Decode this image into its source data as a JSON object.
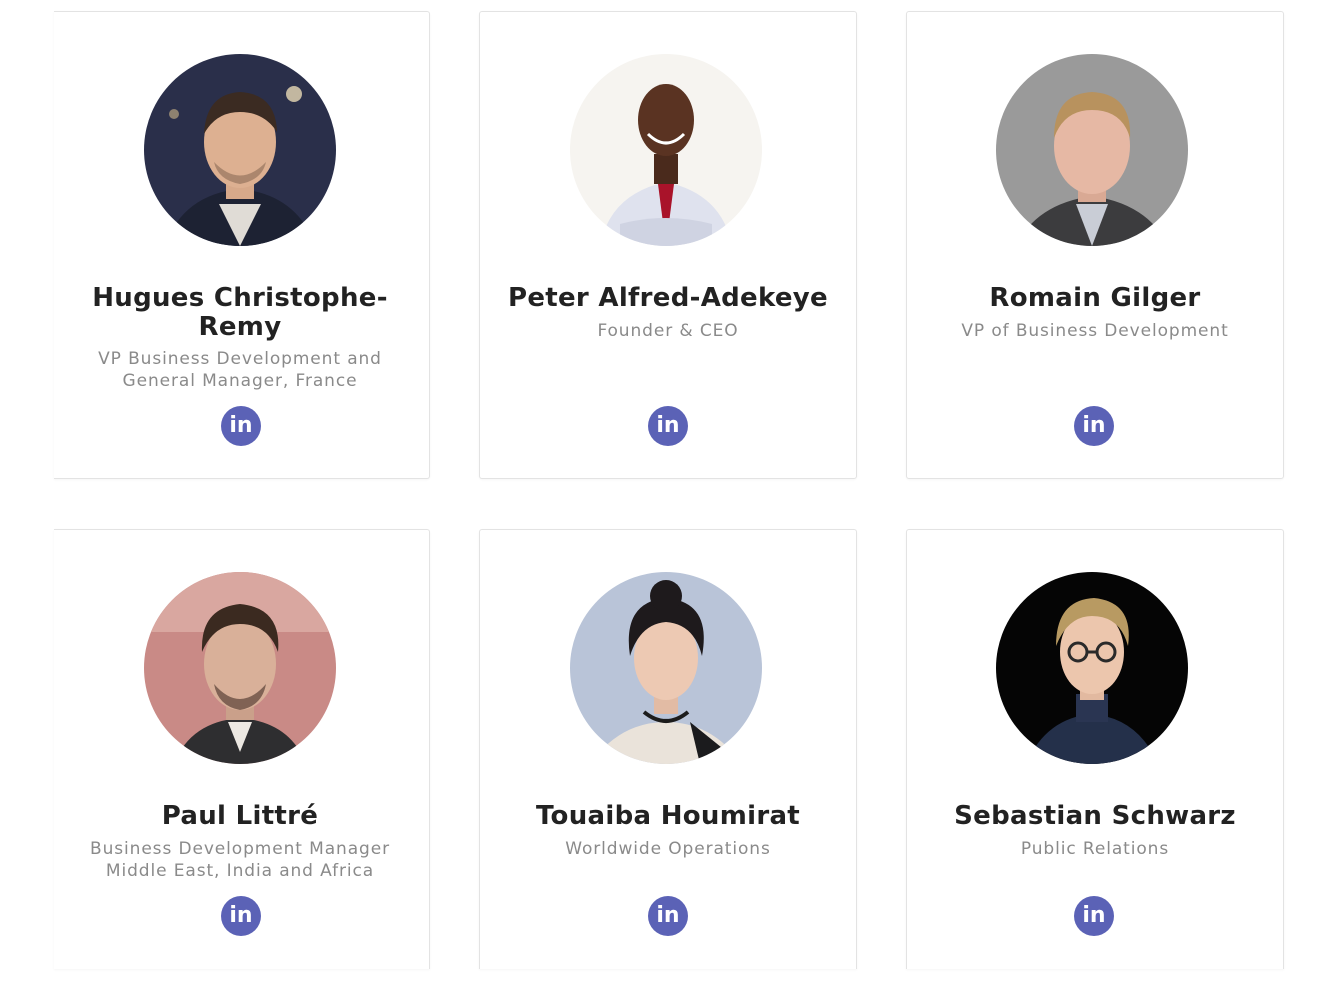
{
  "team": [
    {
      "name": "Hugues Christophe-Remy",
      "name_lines": [
        "Hugues Christophe-",
        "Remy"
      ],
      "role_lines": [
        "VP Business Development and",
        "General Manager, France"
      ],
      "linkedin_label": "in"
    },
    {
      "name": "Peter Alfred-Adekeye",
      "name_lines": [
        "Peter Alfred-Adekeye"
      ],
      "role_lines": [
        "Founder & CEO"
      ],
      "linkedin_label": "in"
    },
    {
      "name": "Romain Gilger",
      "name_lines": [
        "Romain Gilger"
      ],
      "role_lines": [
        "VP of Business Development"
      ],
      "linkedin_label": "in"
    },
    {
      "name": "Paul Littré",
      "name_lines": [
        "Paul Littré"
      ],
      "role_lines": [
        "Business Development Manager",
        "Middle East, India and Africa"
      ],
      "linkedin_label": "in"
    },
    {
      "name": "Touaiba Houmirat",
      "name_lines": [
        "Touaiba Houmirat"
      ],
      "role_lines": [
        "Worldwide Operations"
      ],
      "linkedin_label": "in"
    },
    {
      "name": "Sebastian Schwarz",
      "name_lines": [
        "Sebastian Schwarz"
      ],
      "role_lines": [
        "Public Relations"
      ],
      "linkedin_label": "in"
    }
  ],
  "colors": {
    "linkedin_badge": "#5b62b6",
    "name_text": "#222222",
    "role_text": "#8a8a8a",
    "card_border": "#e3e3e3"
  },
  "icons": {
    "linkedin": "linkedin-icon"
  }
}
